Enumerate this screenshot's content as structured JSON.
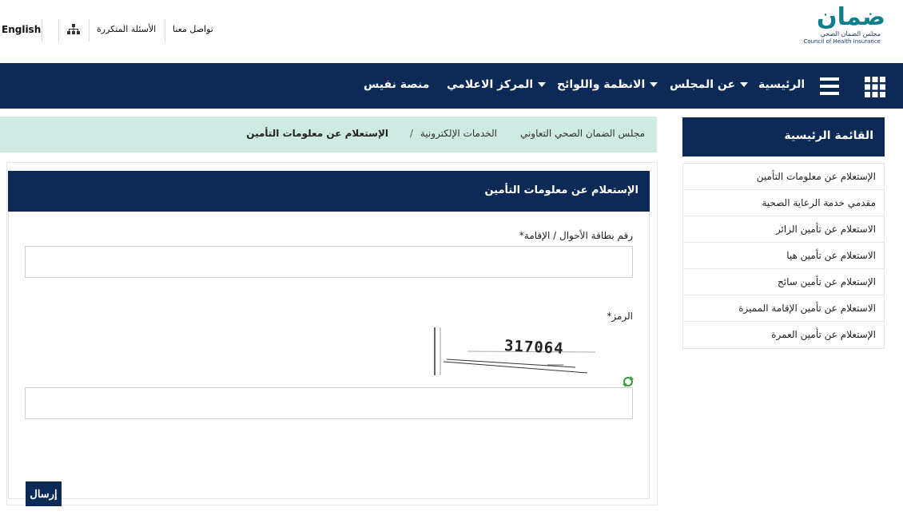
{
  "topbar": {
    "language": "English",
    "faq": "الأسئلة المتكررة",
    "contact": "تواصل معنا"
  },
  "logo": {
    "arabic": "ضمان",
    "subtitle_ar": "مجلس الضمان الصحي",
    "subtitle_en": "Council of Health Insurance"
  },
  "nav": {
    "items": [
      {
        "label": "الرئيسية"
      },
      {
        "label": "عن المجلس"
      },
      {
        "label": "الانظمة واللوائح"
      },
      {
        "label": "المركز الاعلامي"
      },
      {
        "label": "منصة نفيس"
      }
    ]
  },
  "breadcrumb": {
    "items": [
      "مجلس الضمان الصحي التعاوني",
      "الخدمات الإلكترونية",
      "الإستعلام عن معلومات التأمين"
    ],
    "separator": "/"
  },
  "sidebar": {
    "title": "القائمة الرئيسية",
    "items": [
      {
        "label": "الإستعلام عن معلومات التأمين"
      },
      {
        "label": "مقدمي خدمة الرعاية الصحية"
      },
      {
        "label": "الاستعلام عن تأمين الزائر"
      },
      {
        "label": "الاستعلام عن تأمين هيا"
      },
      {
        "label": "الإستعلام عن تأمين سائح"
      },
      {
        "label": "الاستعلام عن تأمين الإقامة المميزة"
      },
      {
        "label": "الإستعلام عن تأمين العمرة"
      }
    ]
  },
  "form": {
    "title": "الإستعلام عن معلومات التأمين",
    "id_label": "رقم بطاقة الأحوال / الإقامة*",
    "id_value": "",
    "code_label": "الرمز*",
    "captcha_text": "317064",
    "code_value": "",
    "submit_label": "إرسال"
  },
  "colors": {
    "navy": "#0d2a57",
    "breadcrumb_bg": "#cdeae3",
    "logo_teal": "#0d7f8a"
  }
}
